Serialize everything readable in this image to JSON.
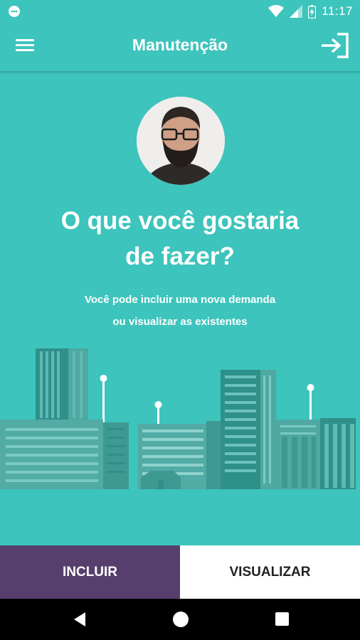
{
  "status_bar": {
    "time": "11:17",
    "icons": [
      "notification-icon",
      "wifi-icon",
      "signal-icon",
      "battery-icon"
    ]
  },
  "app_bar": {
    "title": "Manutenção",
    "left_icon": "menu-icon",
    "right_icon": "logout-icon"
  },
  "main": {
    "avatar": "user-avatar-photo",
    "headline_line1": "O que você gostaria",
    "headline_line2": "de fazer?",
    "subtitle_line1": "Você pode incluir uma nova demanda",
    "subtitle_line2": "ou visualizar as existentes",
    "illustration": "city-skyline"
  },
  "actions": {
    "incluir_label": "INCLUIR",
    "visualizar_label": "VISUALIZAR"
  },
  "nav_bar": {
    "icons": [
      "back-icon",
      "home-icon",
      "recents-icon"
    ]
  },
  "colors": {
    "primary": "#3dc4bc",
    "accent_purple": "#563f6d",
    "white": "#ffffff"
  }
}
